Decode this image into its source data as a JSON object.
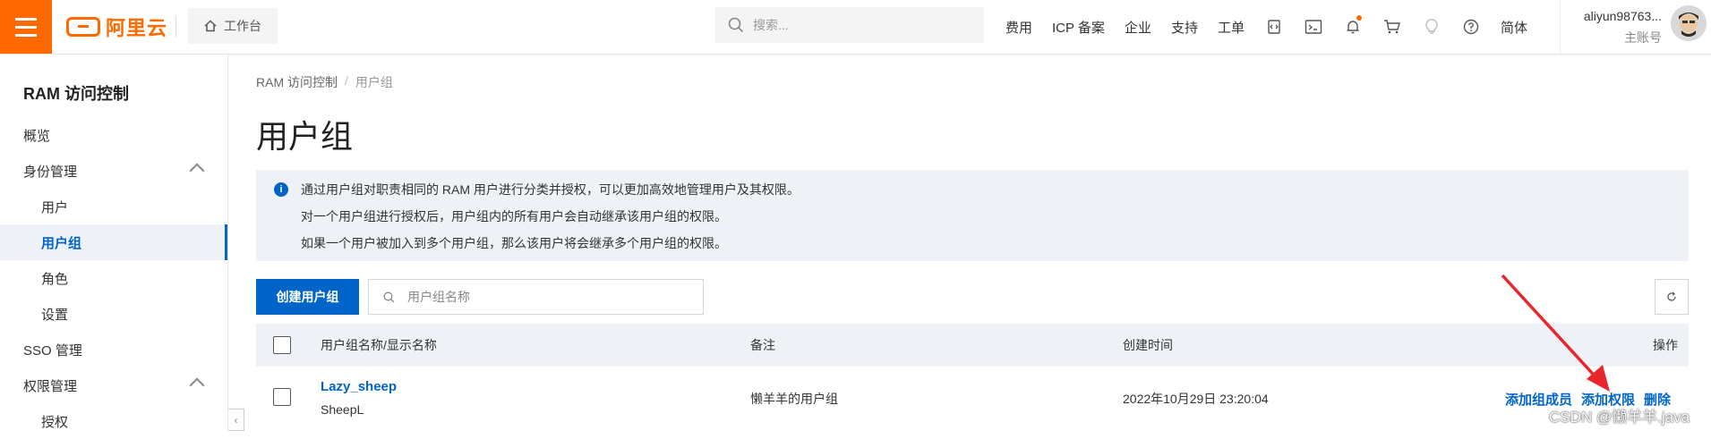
{
  "header": {
    "brand": "阿里云",
    "workbench": "工作台",
    "search_placeholder": "搜索...",
    "nav_items": [
      "费用",
      "ICP 备案",
      "企业",
      "支持",
      "工单"
    ],
    "language": "简体",
    "user_name": "aliyun98763...",
    "user_role": "主账号",
    "icons": [
      "code-icon",
      "terminal-icon",
      "bell-icon",
      "cart-icon",
      "bulb-icon",
      "help-icon"
    ]
  },
  "sidebar": {
    "title": "RAM 访问控制",
    "items": [
      {
        "label": "概览"
      },
      {
        "label": "身份管理"
      },
      {
        "label": "用户"
      },
      {
        "label": "用户组"
      },
      {
        "label": "角色"
      },
      {
        "label": "设置"
      },
      {
        "label": "SSO 管理"
      },
      {
        "label": "权限管理"
      },
      {
        "label": "授权"
      }
    ]
  },
  "breadcrumb": [
    "RAM 访问控制",
    "用户组"
  ],
  "page_title": "用户组",
  "info": [
    "通过用户组对职责相同的 RAM 用户进行分类并授权，可以更加高效地管理用户及其权限。",
    "对一个用户组进行授权后，用户组内的所有用户会自动继承该用户组的权限。",
    "如果一个用户被加入到多个用户组，那么该用户将会继承多个用户组的权限。"
  ],
  "toolbar": {
    "create_label": "创建用户组",
    "filter_placeholder": "用户组名称"
  },
  "table": {
    "columns": [
      "用户组名称/显示名称",
      "备注",
      "创建时间",
      "操作"
    ],
    "rows": [
      {
        "name": "Lazy_sheep",
        "display_name": "SheepL",
        "note": "懒羊羊的用户组",
        "created": "2022年10月29日 23:20:04",
        "actions": [
          "添加组成员",
          "添加权限",
          "删除"
        ]
      }
    ]
  },
  "watermark": "CSDN @懒羊羊.java",
  "colors": {
    "brand": "#ff6a00",
    "primary": "#0064c8",
    "annotation": "#e8262b"
  }
}
